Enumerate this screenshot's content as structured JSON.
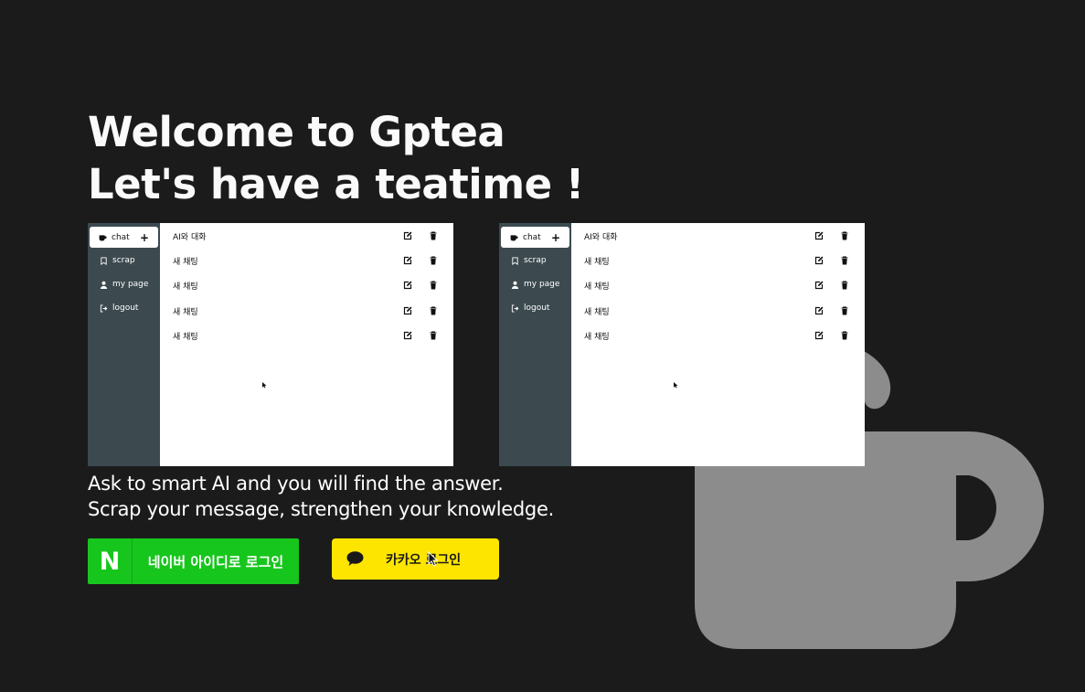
{
  "hero": {
    "line1": "Welcome to Gptea",
    "line2": "Let's have a teatime !"
  },
  "preview": {
    "sidebar": {
      "chat_label": "chat",
      "new_chat_symbol": "+",
      "items": [
        {
          "label": "scrap",
          "icon": "bookmark-icon"
        },
        {
          "label": "my page",
          "icon": "user-icon"
        },
        {
          "label": "logout",
          "icon": "logout-icon"
        }
      ]
    },
    "chats": [
      {
        "title": "AI와 대화"
      },
      {
        "title": "새 채팅"
      },
      {
        "title": "새 채팅"
      },
      {
        "title": "새 채팅"
      },
      {
        "title": "새 채팅"
      }
    ]
  },
  "description": {
    "line1": "Ask to smart AI and you will find the answer.",
    "line2": "Scrap your message, strengthen your knowledge."
  },
  "login": {
    "naver_logo": "N",
    "naver_label": "네이버 아이디로 로그인",
    "kakao_label": "카카오 로그인"
  },
  "colors": {
    "background": "#1b1b1b",
    "cup": "#8c8c8c",
    "sidebar": "#3c4a50",
    "naver": "#17c61d",
    "kakao": "#fee500"
  }
}
